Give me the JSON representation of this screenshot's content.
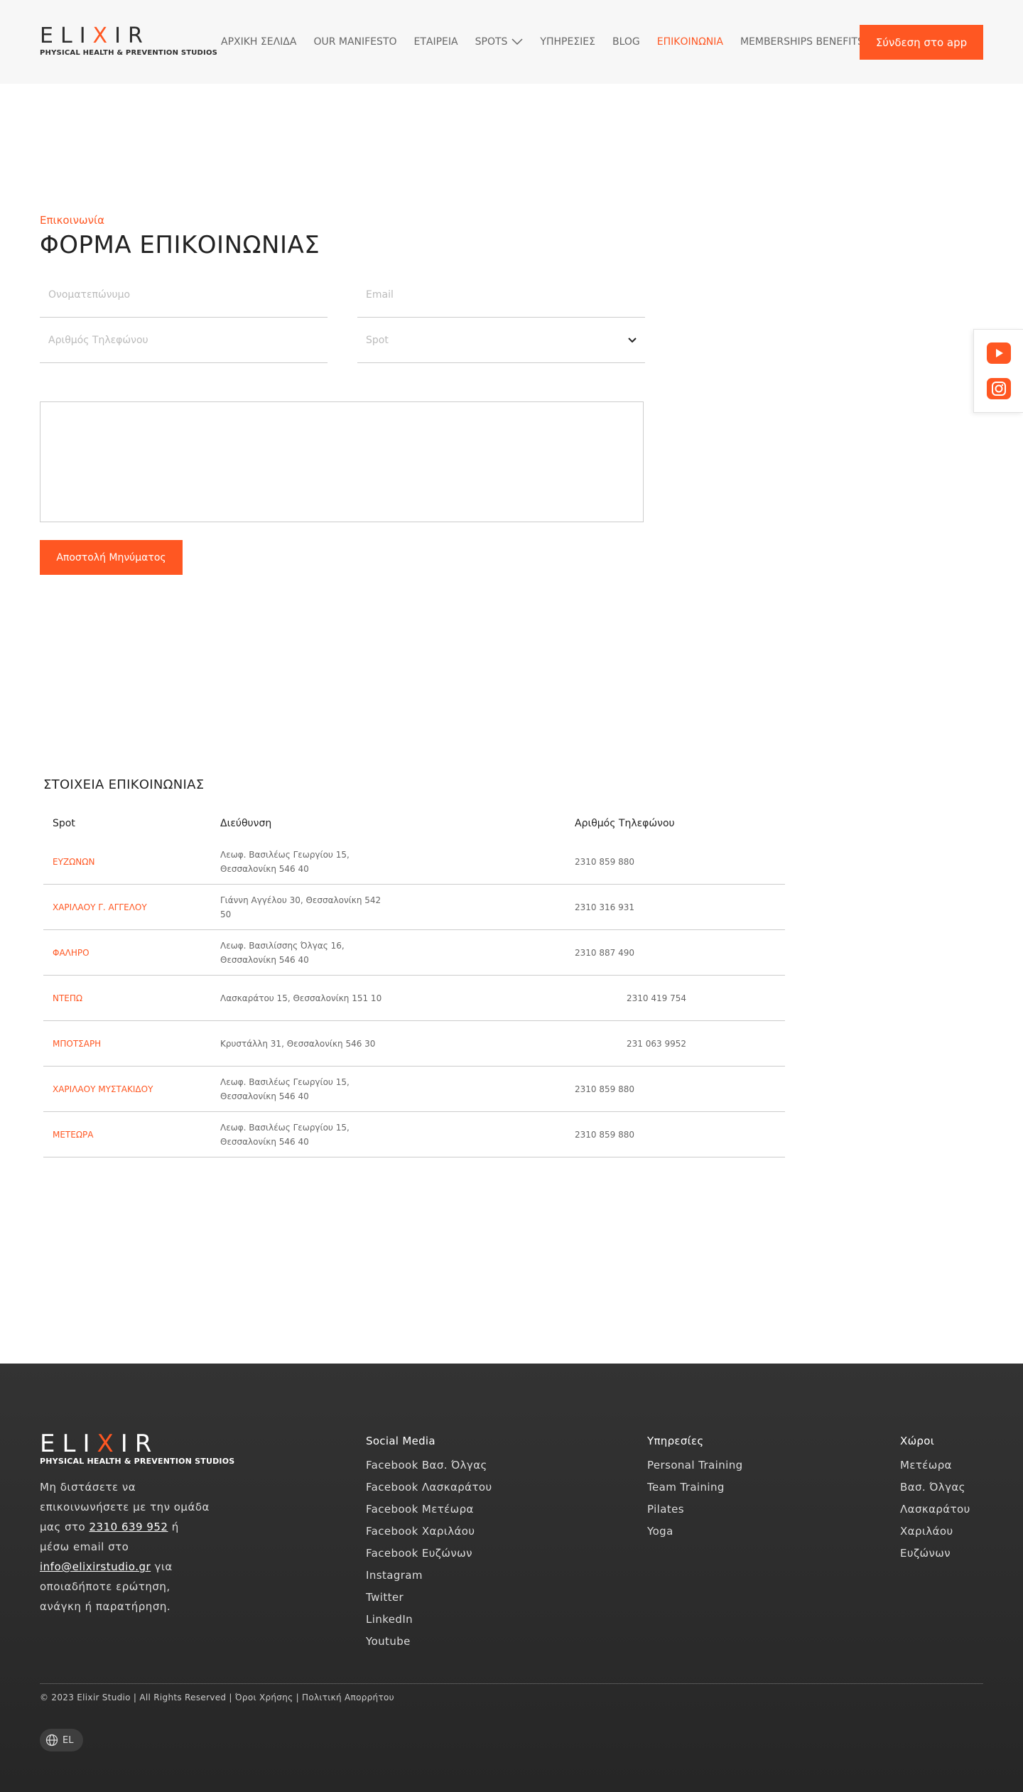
{
  "header": {
    "logo_word": [
      "E",
      "L",
      "I",
      "X",
      "I",
      "R"
    ],
    "logo_tagline": "PHYSICAL HEALTH & PREVENTION STUDIOS",
    "nav": [
      {
        "label": "ΑΡΧΙΚΗ ΣΕΛΙΔΑ",
        "active": false
      },
      {
        "label": "OUR MANIFESTO",
        "active": false
      },
      {
        "label": "ΕΤΑΙΡΕΙΑ",
        "active": false
      },
      {
        "label": "SPOTS",
        "active": false,
        "dropdown": true
      },
      {
        "label": "ΥΠΗΡΕΣΙΕΣ",
        "active": false
      },
      {
        "label": "BLOG",
        "active": false
      },
      {
        "label": "ΕΠΙΚΟΙΝΩΝΙΑ",
        "active": true
      },
      {
        "label": "MEMBERSHIPS BENEFITS",
        "active": false
      }
    ],
    "cta_label": "Σύνδεση στο app"
  },
  "form": {
    "eyebrow": "Επικοινωνία",
    "title": "ΦΟΡΜΑ ΕΠΙΚΟΙΝΩΝΙΑΣ",
    "name_placeholder": "Ονοματεπώνυμο",
    "email_placeholder": "Email",
    "phone_placeholder": "Αριθμός Τηλεφώνου",
    "spot_placeholder": "Spot",
    "submit_label": "Αποστολή Μηνύματος"
  },
  "side_social": [
    "youtube-icon",
    "instagram-icon"
  ],
  "contacts": {
    "title": "ΣΤΟΙΧΕΙΑ ΕΠΙΚΟΙΝΩΝΙΑΣ",
    "headers": [
      "Spot",
      "Διεύθυνση",
      "Αριθμός Τηλεφώνου"
    ],
    "rows": [
      {
        "spot": "ΕΥΖΩΝΩΝ",
        "address": "Λεωφ. Βασιλέως Γεωργίου 15, Θεσσαλονίκη 546 40",
        "phone": "2310 859 880"
      },
      {
        "spot": "ΧΑΡΙΛΑΟΥ Γ. ΑΓΓΕΛΟΥ",
        "address": "Γιάννη Αγγέλου 30, Θεσσαλονίκη 542 50",
        "phone": "2310 316 931"
      },
      {
        "spot": "ΦΑΛΗΡΟ",
        "address": "Λεωφ. Βασιλίσσης Όλγας 16, Θεσσαλονίκη 546 40",
        "phone": "2310 887 490"
      },
      {
        "spot": "ΝΤΕΠΩ",
        "address": "Λασκαράτου 15, Θεσσαλονίκη 151 10",
        "phone": "2310 419 754"
      },
      {
        "spot": "ΜΠΟΤΣΑΡΗ",
        "address": "Κρυστάλλη 31, Θεσσαλονίκη 546 30",
        "phone": "231 063 9952"
      },
      {
        "spot": "ΧΑΡΙΛΑΟΥ ΜΥΣΤΑΚΙΔΟΥ",
        "address": "Λεωφ. Βασιλέως Γεωργίου 15, Θεσσαλονίκη 546 40",
        "phone": "2310 859 880"
      },
      {
        "spot": "ΜΕΤΕΩΡΑ",
        "address": "Λεωφ. Βασιλέως Γεωργίου 15, Θεσσαλονίκη 546 40",
        "phone": "2310 859 880"
      }
    ]
  },
  "footer": {
    "desc_1": "Μη διστάσετε να επικοινωνήσετε με την ομάδα μας στο ",
    "desc_phone": "2310 639 952",
    "desc_2": " ή μέσω email στο ",
    "desc_email": "info@elixirstudio.gr",
    "desc_3": " για οποιαδήποτε ερώτηση, ανάγκη ή παρατήρηση.",
    "social": {
      "title": "Social Media",
      "links": [
        "Facebook Βασ. Όλγας",
        "Facebook Λασκαράτου",
        "Facebook Μετέωρα",
        "Facebook Χαριλάου",
        "Facebook Ευζώνων",
        "Instagram",
        "Twitter",
        "LinkedIn",
        "Youtube"
      ]
    },
    "services": {
      "title": "Υπηρεσίες",
      "links": [
        "Personal Training",
        "Team Training",
        "Pilates",
        "Yoga"
      ]
    },
    "spaces": {
      "title": "Χώροι",
      "links": [
        "Μετέωρα",
        "Βασ. Όλγας",
        "Λασκαράτου",
        "Χαριλάου",
        "Ευζώνων"
      ]
    },
    "copyright": "© 2023 Elixir Studio | All Rights Reserved | Όροι Χρήσης | Πολιτική Απορρήτου",
    "lang": "EL"
  },
  "colors": {
    "accent": "#ff5722",
    "footer_bg": "#2d2d2d"
  }
}
